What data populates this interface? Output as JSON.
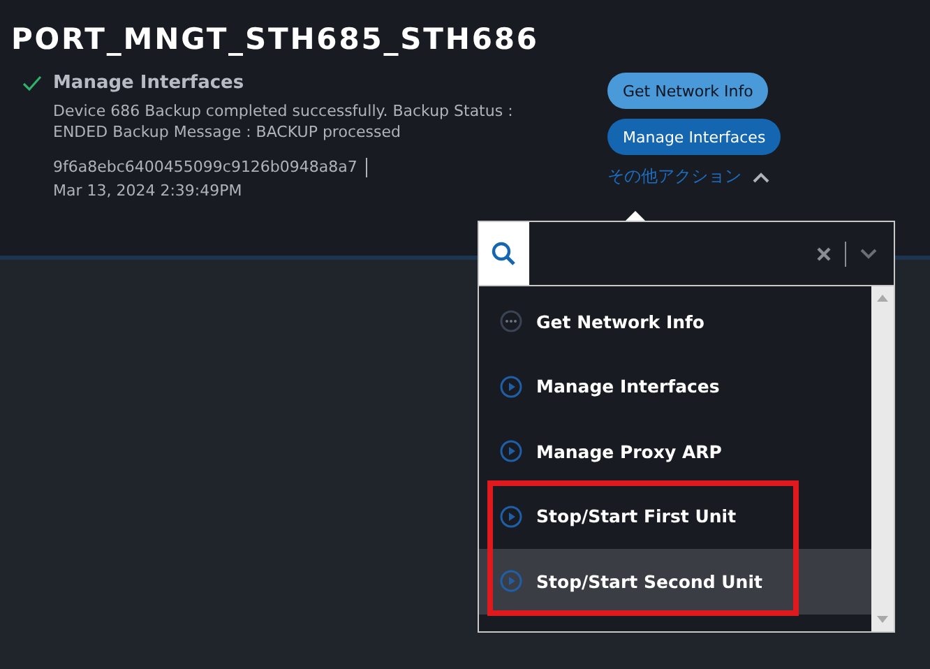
{
  "title": "PORT_MNGT_STH685_STH686",
  "status": {
    "kind": "success",
    "action": "Manage Interfaces",
    "message": "Device 686 Backup completed successfully. Backup Status : ENDED Backup Message : BACKUP processed",
    "id": "9f6a8ebc6400455099c9126b0948a8a7",
    "time": "Mar 13, 2024 2:39:49PM"
  },
  "actions": [
    {
      "label": "Get Network Info",
      "kind": "light"
    },
    {
      "label": "Manage Interfaces",
      "kind": "dark"
    }
  ],
  "more_actions": {
    "label": "その他アクション",
    "expanded": true
  },
  "dropdown": {
    "items": [
      {
        "label": "Get Network Info",
        "kind": "more",
        "highlighted": false,
        "framed": false
      },
      {
        "label": "Manage Interfaces",
        "kind": "run",
        "highlighted": false,
        "framed": false
      },
      {
        "label": "Manage Proxy ARP",
        "kind": "run",
        "highlighted": false,
        "framed": false
      },
      {
        "label": "Stop/Start First Unit",
        "kind": "run",
        "highlighted": false,
        "framed": true
      },
      {
        "label": "Stop/Start Second Unit",
        "kind": "run",
        "highlighted": true,
        "framed": true
      }
    ]
  }
}
